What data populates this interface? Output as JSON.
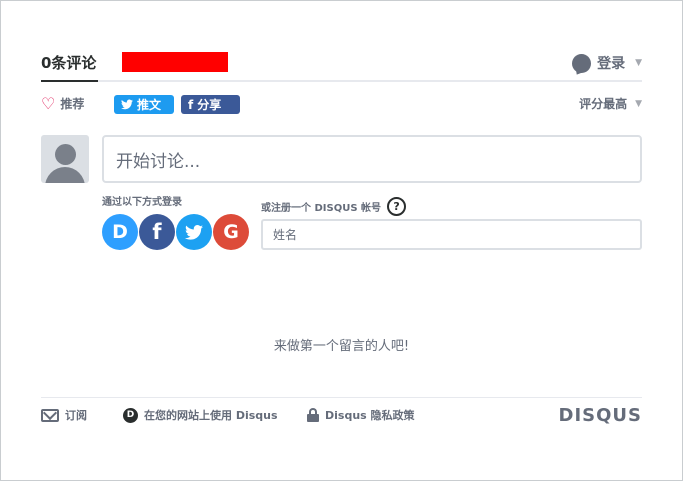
{
  "nav": {
    "comment_count_tab": "0条评论",
    "login_label": "登录",
    "caret": "▼"
  },
  "toolbar": {
    "recommend_label": "推荐",
    "tweet_label": "推文",
    "share_label": "分享",
    "sort_label": "评分最高",
    "caret": "▼"
  },
  "compose": {
    "placeholder": "开始讨论..."
  },
  "signin": {
    "label": "通过以下方式登录",
    "providers": [
      {
        "name": "disqus",
        "glyph": "D"
      },
      {
        "name": "facebook",
        "glyph": "f"
      },
      {
        "name": "twitter",
        "glyph": "🐦"
      },
      {
        "name": "google",
        "glyph": "G"
      }
    ]
  },
  "register": {
    "label": "或注册一个 DISQUS 帐号",
    "help_glyph": "?",
    "name_placeholder": "姓名"
  },
  "empty": {
    "message": "来做第一个留言的人吧!"
  },
  "footer": {
    "subscribe_label": "订阅",
    "add_disqus_label": "在您的网站上使用 Disqus",
    "privacy_label": "Disqus 隐私政策",
    "brand": "DISQUS"
  },
  "colors": {
    "accent_blue": "#2e9fff",
    "twitter": "#1d9bf0",
    "facebook": "#3b5998",
    "google": "#dd4b39",
    "redaction": "#ff0000"
  }
}
